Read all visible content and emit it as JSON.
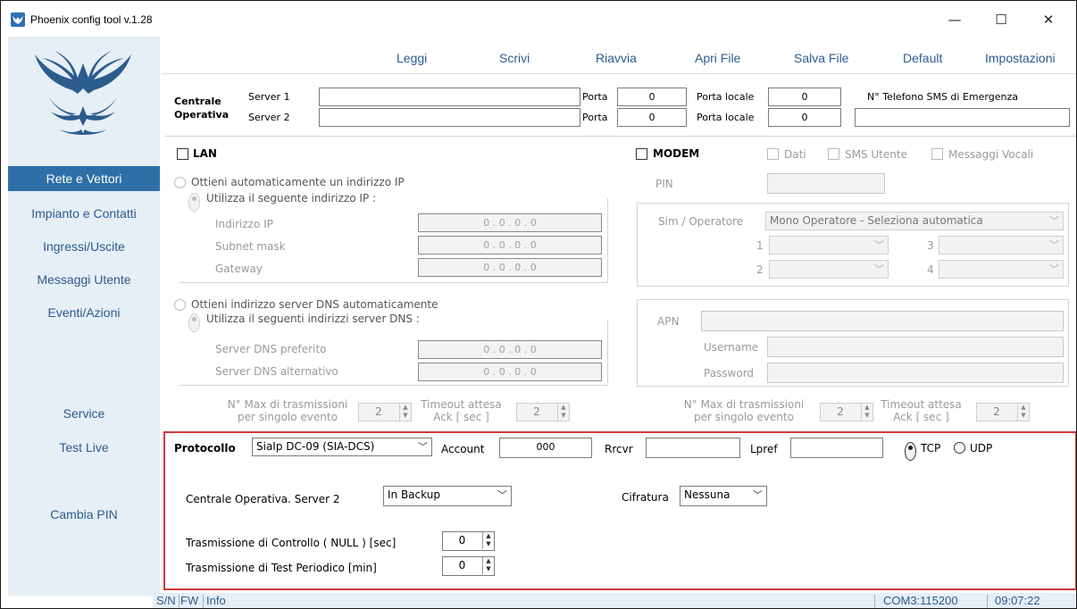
{
  "window": {
    "title": "Phoenix config tool v.1.28",
    "minimize": "—",
    "maximize": "☐",
    "close": "✕"
  },
  "sidebar": {
    "items": [
      "Rete e Vettori",
      "Impianto e Contatti",
      "Ingressi/Uscite",
      "Messaggi Utente",
      "Eventi/Azioni",
      "Service",
      "Test Live",
      "Cambia PIN"
    ]
  },
  "menu": [
    "Leggi",
    "Scrivi",
    "Riavvia",
    "Apri File",
    "Salva File",
    "Default",
    "Impostazioni"
  ],
  "central": {
    "label1": "Centrale",
    "label2": "Operativa",
    "server1_label": "Server 1",
    "server2_label": "Server 2",
    "server1_value": "",
    "server2_value": "",
    "porta_label": "Porta",
    "porta1": "0",
    "porta2": "0",
    "porta_locale_label": "Porta locale",
    "porta_locale1": "0",
    "porta_locale2": "0",
    "sms_label": "N° Telefono SMS di Emergenza",
    "sms_value": ""
  },
  "lan": {
    "title": "LAN",
    "auto_ip": "Ottieni automaticamente un indirizzo IP",
    "manual_ip": "Utilizza il seguente indirizzo IP :",
    "ip_label": "Indirizzo IP",
    "subnet_label": "Subnet mask",
    "gateway_label": "Gateway",
    "ip_value": "0   .   0   .   0   .   0",
    "auto_dns": "Ottieni indirizzo server DNS automaticamente",
    "manual_dns": "Utilizza il seguenti indirizzi server DNS :",
    "dns1_label": "Server DNS preferito",
    "dns2_label": "Server DNS alternativo",
    "max_tx_1": "N° Max di trasmissioni",
    "max_tx_2": "per singolo evento",
    "max_tx_value": "2",
    "timeout_1": "Timeout attesa",
    "timeout_2": "Ack [ sec ]",
    "timeout_value": "2"
  },
  "modem": {
    "title": "MODEM",
    "dati": "Dati",
    "sms_utente": "SMS Utente",
    "messaggi_vocali": "Messaggi Vocali",
    "pin_label": "PIN",
    "sim_label": "Sim / Operatore",
    "sim_value": "Mono Operatore - Seleziona automatica",
    "op1": "1",
    "op2": "2",
    "op3": "3",
    "op4": "4",
    "apn_label": "APN",
    "username_label": "Username",
    "password_label": "Password",
    "max_tx_1": "N° Max di trasmissioni",
    "max_tx_2": "per singolo evento",
    "max_tx_value": "2",
    "timeout_1": "Timeout attesa",
    "timeout_2": "Ack [ sec ]",
    "timeout_value": "2"
  },
  "protocol": {
    "label": "Protocollo",
    "value": "SiaIp DC-09 (SIA-DCS)",
    "account_label": "Account",
    "account_value": "000",
    "rrcvr_label": "Rrcvr",
    "rrcvr_value": "",
    "lpref_label": "Lpref",
    "lpref_value": "",
    "tcp": "TCP",
    "udp": "UDP",
    "server2_label": "Centrale Operativa. Server 2",
    "server2_value": "In Backup",
    "cifratura_label": "Cifratura",
    "cifratura_value": "Nessuna",
    "null_label": "Trasmissione di Controllo ( NULL ) [sec]",
    "null_value": "0",
    "test_label": "Trasmissione di Test Periodico [min]",
    "test_value": "0"
  },
  "status": {
    "sn": "S/N",
    "fw": "FW",
    "info": "Info",
    "com": "COM3:115200",
    "time": "09:07:22"
  }
}
